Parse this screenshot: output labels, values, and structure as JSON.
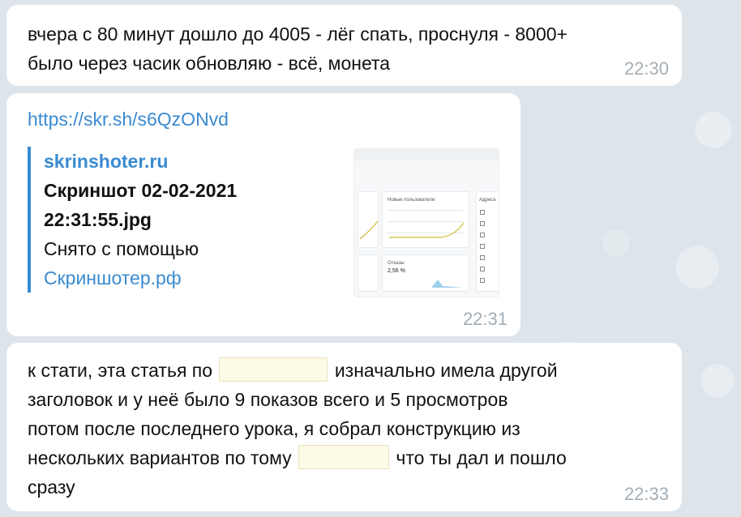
{
  "messages": [
    {
      "lines": [
        "вчера с 80 минут дошло до 4005 - лёг спать, проснуля - 8000+",
        "было через часик обновляю - всё, монета"
      ],
      "time": "22:30"
    },
    {
      "url": "https://skr.sh/s6QzONvd",
      "preview": {
        "site": "skrinshoter.ru",
        "title_line1": "Скриншот 02-02-2021",
        "title_line2": "22:31:55.jpg",
        "description": "Снято с помощью",
        "link": "Скриншотер.рф",
        "thumbnail": {
          "card1_title": "Новые пользователи",
          "card2_title": "Отказы",
          "card2_value": "2,56 %",
          "sidebar_title": "Адреса"
        }
      },
      "time": "22:31"
    },
    {
      "line1_a": "к стати, эта статья по",
      "line1_b": "изначально имела другой",
      "line2": "заголовок и у неё было 9 показов всего и 5 просмотров",
      "line3": "потом после последнего урока, я собрал конструкцию из",
      "line4_a": "нескольких вариантов по тому",
      "line4_b": "что ты дал и пошло",
      "line5": "сразу",
      "time": "22:33"
    }
  ],
  "colors": {
    "link": "#3a8bd0",
    "time": "#a3adb5",
    "bubble": "#ffffff",
    "background": "#dde5eb",
    "redaction": "#fdfae6"
  }
}
